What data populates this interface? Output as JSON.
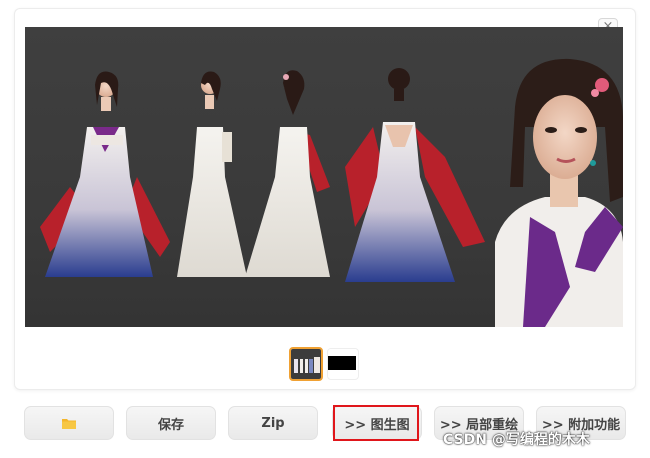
{
  "gallery": {
    "close_glyph": "×",
    "main_image_icon": "character-turnaround-illustration",
    "thumbnails": [
      {
        "name": "thumbnail-turnaround",
        "selected": true
      },
      {
        "name": "thumbnail-dark",
        "selected": false
      }
    ],
    "selected_border_color": "#f0a133"
  },
  "toolbar": {
    "open_folder_icon": "folder-icon",
    "save_label": "保存",
    "zip_label": "Zip",
    "img2img_label": ">> 图生图",
    "inpaint_label": ">> 局部重绘",
    "extras_label": ">> 附加功能",
    "highlight_color": "#e0161b"
  },
  "watermark": "CSDN @写编程的木木"
}
